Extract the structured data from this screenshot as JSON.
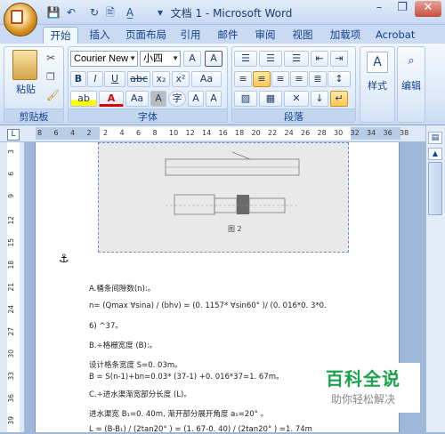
{
  "title_bar": {
    "doc_title": "文档 1 - Microsoft Word",
    "minimize": "–",
    "restore": "❐",
    "close": "✕"
  },
  "quick_access": {
    "save": "💾",
    "undo": "↶",
    "redo": "↻",
    "print_preview": "🖹",
    "ab": "A̲",
    "more": "▾"
  },
  "tabs": [
    "开始",
    "插入",
    "页面布局",
    "引用",
    "邮件",
    "审阅",
    "视图",
    "加载项",
    "Acrobat"
  ],
  "clipboard": {
    "paste_label": "粘贴",
    "group_label": "剪贴板"
  },
  "font": {
    "name": "Courier New",
    "size": "小四",
    "group_label": "字体",
    "grow": "A",
    "shrink": "A",
    "clear": "Aa",
    "bold": "B",
    "italic": "I",
    "underline": "U",
    "strike": "abc",
    "sub": "x₂",
    "sup": "x²",
    "highlight": "ab",
    "color": "A",
    "case": "Aa",
    "charshade": "A",
    "enclose": "字",
    "phonetic": "A",
    "a_up": "A",
    "a_dn": "A"
  },
  "paragraph": {
    "group_label": "段落"
  },
  "styles": {
    "label": "样式"
  },
  "editing": {
    "label": "编辑"
  },
  "hruler_ticks": [
    "8",
    "6",
    "4",
    "2",
    "2",
    "4",
    "6",
    "8",
    "10",
    "12",
    "14",
    "16",
    "18",
    "20",
    "22",
    "24",
    "26",
    "28",
    "30",
    "32",
    "34",
    "36",
    "38"
  ],
  "vruler_ticks": [
    "3",
    "6",
    "9",
    "12",
    "15",
    "18",
    "21",
    "24",
    "27",
    "30",
    "33",
    "36",
    "39"
  ],
  "figure": {
    "caption": "图 2"
  },
  "doc_lines": [
    "A.桶条间隙数(n):。",
    "n= (Qmax ∀sina) / (bhv) = (0. 1157* ∀sin60° )/ (0. 016*0. 3*0.",
    "6) ^37。",
    "B.÷格栅宽度 (B):。",
    "设计格条宽度 S=0. 03m。",
    "B = S(n-1)+bn=0.03* (37-1) +0. 016*37=1. 67m。",
    "C.÷进水渠渐宽部分长度 (L)。",
    "进水渠宽 B₁=0. 40m, 渐开部分展开角度 a₁=20° 。",
    "L = (B-B₁) / (2tan20° ) = (1. 67-0. 40) / (2tan20° ) =1. 74m"
  ],
  "watermark": {
    "title": "百科全说",
    "subtitle": "助你轻松解决"
  }
}
